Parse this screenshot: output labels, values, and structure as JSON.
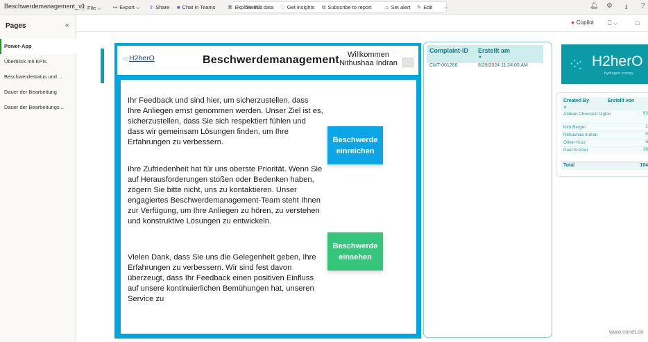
{
  "titlebar": {
    "doc_title": "Beschwerdemanagement_v1",
    "search_placeholder": "Search"
  },
  "pages": {
    "header": "Pages",
    "items": [
      {
        "label": "Power-App",
        "active": true
      },
      {
        "label": "Überblick mit KPIs"
      },
      {
        "label": "Beschwerdestatus und ..."
      },
      {
        "label": "Dauer der Bearbeitung"
      },
      {
        "label": "Dauer der Bearbeitungs..."
      }
    ]
  },
  "commandbar": {
    "file": "File",
    "export": "Export",
    "share": "Share",
    "chat_in_teams": "Chat in Teams",
    "explore": "Explore this data",
    "insights": "Get insights",
    "subscribe": "Subscribe to report",
    "alert": "Set alert",
    "edit": "Edit",
    "more": "···",
    "copilot": "Copilot"
  },
  "report": {
    "logo_small": "H2herO",
    "title": "Beschwerdemanagement",
    "welcome_line1": "Willkommen",
    "welcome_line2": "Nithushaa Indran",
    "paragraph1": "Ihr Feedback und sind hier, um sicherzustellen, dass Ihre Anliegen ernst genommen werden. Unser Ziel ist es, sicherzustellen, dass Sie sich respektiert fühlen und dass wir gemeinsam Lösungen finden, um Ihre Erfahrungen zu verbessern.",
    "paragraph2": "Ihre Zufriedenheit hat für uns oberste Priorität. Wenn Sie auf Herausforderungen stoßen oder Bedenken haben, zögern Sie bitte nicht, uns zu kontaktieren. Unser engagiertes Beschwerdemanagement-Team steht Ihnen zur Verfügung, um Ihre Anliegen zu hören, zu verstehen und konstruktive Lösungen zu entwickeln.",
    "paragraph3": "Vielen Dank, dass Sie uns die Gelegenheit geben, Ihre Erfahrungen zu verbessern. Wir sind fest davon überzeugt, dass Ihr Feedback einen positiven Einfluss auf unsere kontinuierlichen Bemühungen hat, unseren Service zu",
    "btn_submit_line1": "Beschwerde",
    "btn_submit_line2": "einreichen",
    "btn_view_line1": "Beschwerde",
    "btn_view_line2": "einsehen"
  },
  "complaint_table": {
    "col1": "Complaint-ID",
    "col2": "Erstellt am",
    "rows": [
      {
        "id": "CMT-001266",
        "created": "8/29/2024 11:24:05 AM"
      }
    ]
  },
  "big_logo": {
    "word": "H2herO",
    "tagline": "hydrogen energy"
  },
  "created_by_table": {
    "col1": "Created By",
    "col2": "Erstellt von",
    "rows": [
      {
        "name": "Atakan Chousein Oglou",
        "value": "53"
      },
      {
        "name": "Kim Berger",
        "value": "2"
      },
      {
        "name": "Nithushaa Indran",
        "value": "5"
      },
      {
        "name": "Oliver Kurz",
        "value": "6"
      },
      {
        "name": "Paul Kretzel",
        "value": "38"
      }
    ],
    "total_label": "Total",
    "total_value": "104"
  },
  "footer": {
    "url": "www.conet.de"
  },
  "colors": {
    "frame_blue": "#00a6df",
    "button_submit": "#0ea5e6",
    "button_view": "#34c57a",
    "teal_text": "#0b7d8a",
    "logo_bg": "#0c9aa6"
  }
}
